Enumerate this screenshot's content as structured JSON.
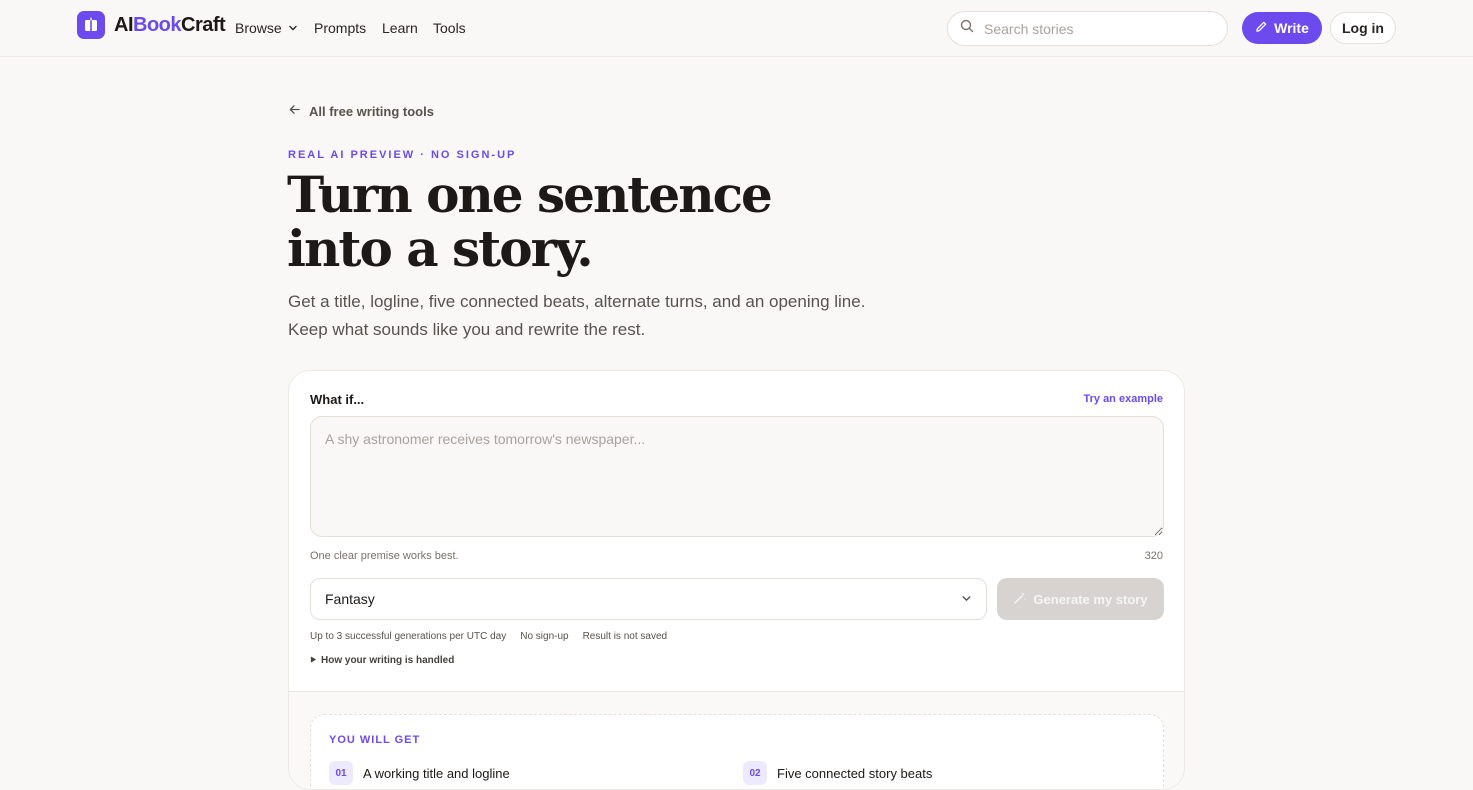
{
  "header": {
    "brand_prefix": "AI",
    "brand_accent": "Book",
    "brand_suffix": "Craft",
    "nav": [
      "Browse",
      "Prompts",
      "Learn",
      "Tools"
    ],
    "search_placeholder": "Search stories",
    "write_label": "Write",
    "login_label": "Log in"
  },
  "hero": {
    "back_label": "All free writing tools",
    "eyebrow": "REAL AI PREVIEW · NO SIGN-UP",
    "headline_line1": "Turn one sentence",
    "headline_line2": "into a story.",
    "sub_line1": "Get a title, logline, five connected beats, alternate turns, and an opening line.",
    "sub_line2": "Keep what sounds like you and rewrite the rest."
  },
  "form": {
    "label": "What if...",
    "try_example": "Try an example",
    "premise_placeholder": "A shy astronomer receives tomorrow's newspaper...",
    "hint": "One clear premise works best.",
    "char_count": "320",
    "genre": "Fantasy",
    "generate_label": "Generate my story",
    "notes": [
      "Up to 3 successful generations per UTC day",
      "No sign-up",
      "Result is not saved"
    ],
    "details_label": "How your writing is handled"
  },
  "you_will_get": {
    "title": "YOU WILL GET",
    "items": [
      {
        "num": "01",
        "label": "A working title and logline"
      },
      {
        "num": "02",
        "label": "Five connected story beats"
      }
    ]
  },
  "colors": {
    "accent": "#6d4aed",
    "background": "#f9f8f6"
  }
}
